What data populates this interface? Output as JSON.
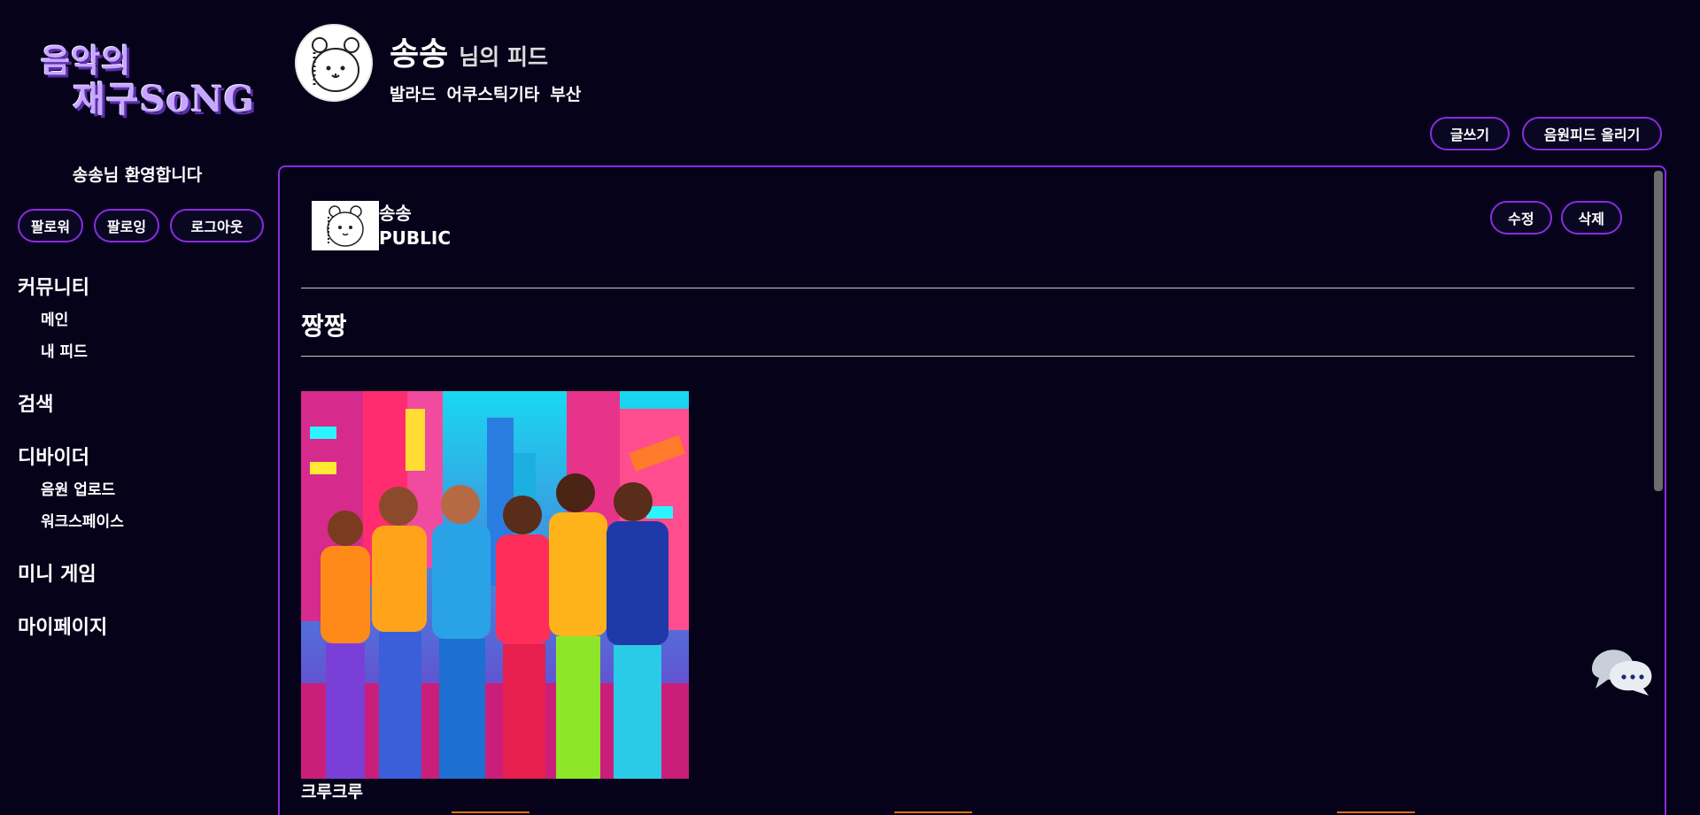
{
  "logo": {
    "line1": "음악의",
    "line2": "재구SoNG"
  },
  "sidebar": {
    "welcome": "송송님 환영합니다",
    "buttons": [
      "팔로워",
      "팔로잉",
      "로그아웃"
    ],
    "sections": [
      {
        "heading": "커뮤니티",
        "items": [
          "메인",
          "내 피드"
        ]
      },
      {
        "heading": "검색",
        "items": []
      },
      {
        "heading": "디바이더",
        "items": [
          "음원 업로드",
          "워크스페이스"
        ]
      },
      {
        "heading": "미니 게임",
        "items": []
      },
      {
        "heading": "마이페이지",
        "items": []
      }
    ]
  },
  "header": {
    "name": "송송",
    "suffix": "님의 피드",
    "tags": [
      "발라드",
      "어쿠스틱기타",
      "부산"
    ],
    "write_label": "글쓰기",
    "upload_feed_label": "음원피드 올리기"
  },
  "post": {
    "author": "송송",
    "visibility": "PUBLIC",
    "edit_label": "수정",
    "delete_label": "삭제",
    "title": "짱짱",
    "image_caption": "크루크루"
  },
  "colors": {
    "background": "#05021a",
    "accent": "#8a2be2",
    "logo": "#c6a7ff"
  },
  "icons": {
    "chat": "chat-bubbles-icon",
    "avatar": "bear-avatar-icon"
  }
}
